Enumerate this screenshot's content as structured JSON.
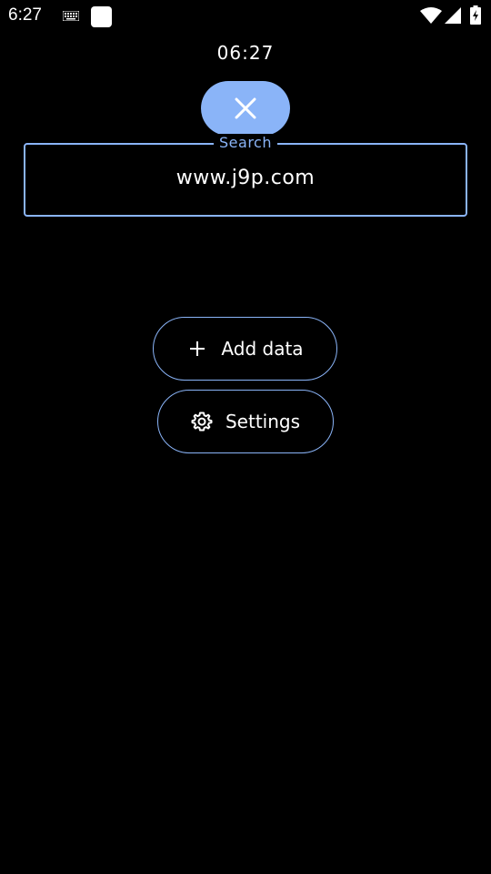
{
  "status_bar": {
    "time": "6:27",
    "icons": [
      "keyboard-icon",
      "notification-icon",
      "wifi-icon",
      "signal-icon",
      "battery-icon"
    ]
  },
  "clock": {
    "time": "06:27"
  },
  "close_button": {
    "icon": "close-icon"
  },
  "search": {
    "label": "Search",
    "value": "www.j9p.com"
  },
  "actions": {
    "add_data_label": "Add data",
    "add_data_icon": "plus-icon",
    "settings_label": "Settings",
    "settings_icon": "gear-icon"
  },
  "colors": {
    "background": "#000000",
    "accent": "#8ab4f8",
    "text": "#ffffff"
  }
}
